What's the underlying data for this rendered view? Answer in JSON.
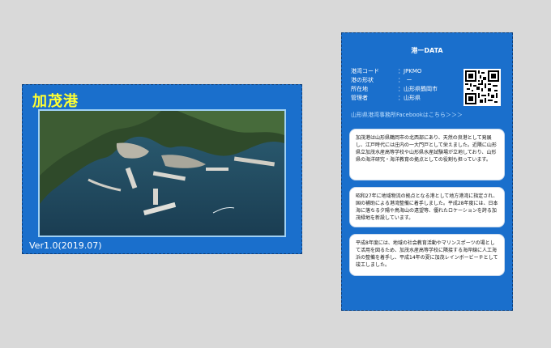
{
  "front": {
    "title": "加茂港",
    "version": "Ver1.0(2019.07)"
  },
  "back": {
    "title": "港ーDATA",
    "info": [
      {
        "key": "港湾コード",
        "value": "：JPKMO"
      },
      {
        "key": "港の形状",
        "value": "：　ー"
      },
      {
        "key": "所在地",
        "value": "：山形県鶴岡市"
      },
      {
        "key": "管理者",
        "value": "：山形県"
      }
    ],
    "facebook_link": "山形県港湾事務所Facebookはこちら＞＞＞",
    "paragraphs": [
      "加茂港は山形県鶴岡市の北西部にあり、天然の良港として発展し、江戸時代には庄内の一大門戸として栄えました。近隣に山形県立加茂水産高等学校や山形県水産試験場が立地しており、山形県の海洋研究・海洋教育の拠点としての役割も担っています。",
      "昭和27年に地域物流の拠点となる港として地方港湾に指定され、国の補助による港湾整備に着手しました。平成28年度には、日本海に落ちる夕陽や鳥海山の遠望等、優れたロケーションを誇る加茂緑地を新設しています。",
      "平成8年度には、地域の社会教育活動やマリンスポーツの場として活用を図るため、加茂水産高等学校に隣接する海岸線に人工海浜の整備を着手し、平成14年の夏に加茂レインボービーチとして竣工しました。"
    ]
  },
  "colors": {
    "card_blue": "#1a6fcc",
    "title_yellow": "#ffff33",
    "background": "#d9d9d9"
  }
}
